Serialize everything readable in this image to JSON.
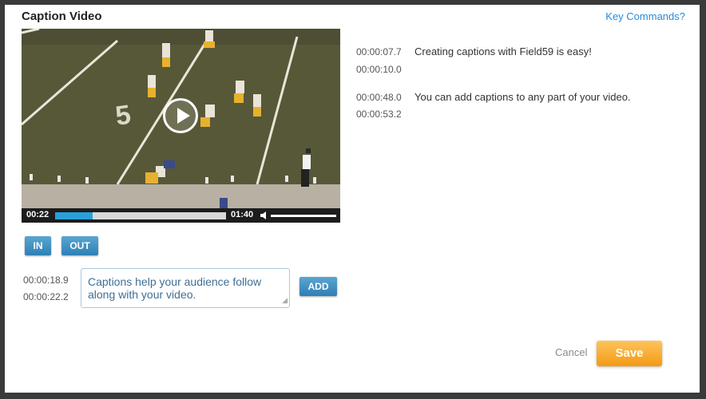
{
  "dialog": {
    "title": "Caption Video",
    "key_commands": "Key Commands?"
  },
  "player": {
    "current_time": "00:22",
    "duration": "01:40",
    "progress_fraction": 0.22,
    "volume_level": 1.0
  },
  "buttons": {
    "in": "IN",
    "out": "OUT",
    "add": "ADD",
    "cancel": "Cancel",
    "save": "Save"
  },
  "new_caption": {
    "start": "00:00:18.9",
    "end": "00:00:22.2",
    "text": "Captions help your audience follow along with your video."
  },
  "captions": [
    {
      "start": "00:00:07.7",
      "end": "00:00:10.0",
      "text": "Creating captions with Field59 is easy!"
    },
    {
      "start": "00:00:48.0",
      "end": "00:00:53.2",
      "text": "You can add captions to any part of your video."
    }
  ],
  "colors": {
    "accent_blue": "#2f7fb4",
    "progress": "#2aa0d8",
    "save_orange": "#f39a14",
    "link": "#2b8ad6"
  }
}
